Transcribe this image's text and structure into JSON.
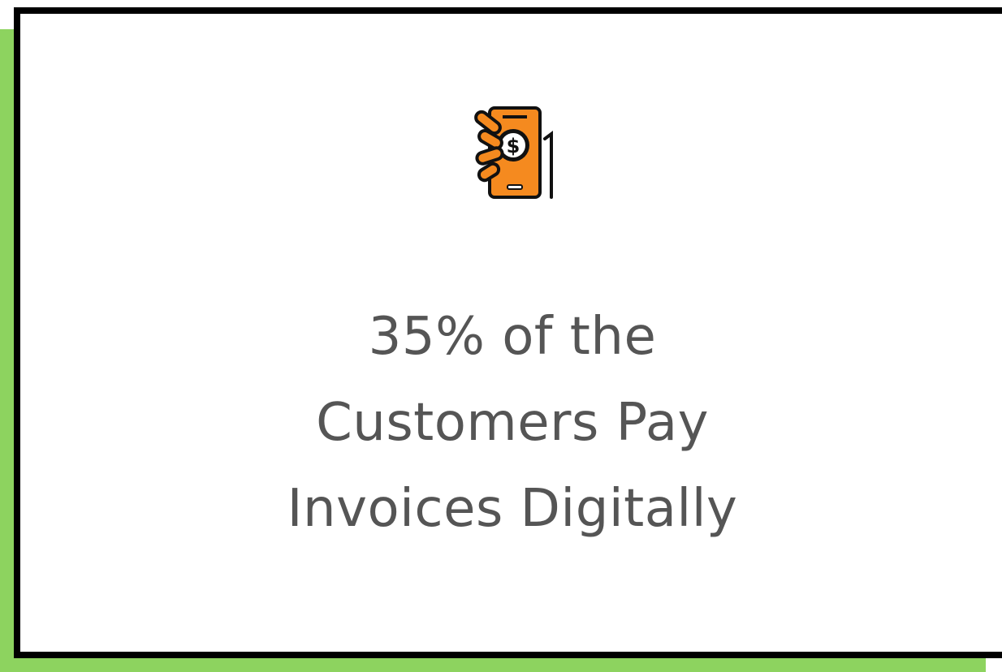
{
  "card": {
    "icon": "hand-holding-phone-dollar-icon",
    "headline_lines": [
      "35% of the",
      "Customers Pay",
      "Invoices Digitally"
    ]
  },
  "colors": {
    "accent_green": "#8dd35f",
    "icon_orange": "#f58a1f",
    "frame": "#000000",
    "text": "#555555"
  }
}
